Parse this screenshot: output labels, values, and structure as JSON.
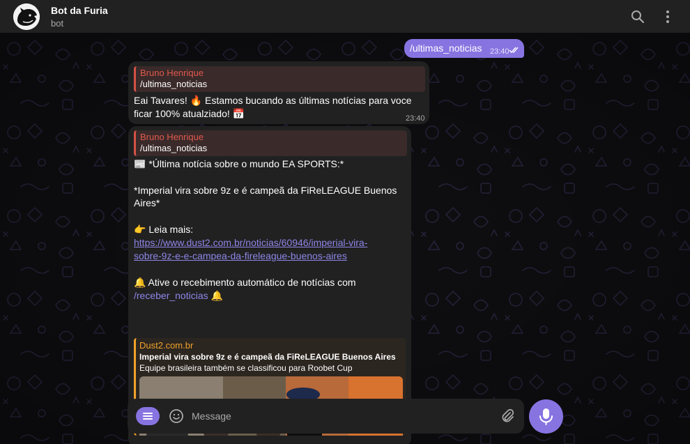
{
  "header": {
    "title": "Bot da Furia",
    "subtitle": "bot",
    "search_icon": "search-icon",
    "more_icon": "more-vertical-icon"
  },
  "messages": {
    "outgoing": {
      "text": "/ultimas_noticias",
      "time": "23:40",
      "status_icon": "double-check-icon"
    },
    "reply1": {
      "reply_name": "Bruno Henrique",
      "reply_text": "/ultimas_noticias",
      "line1": "Eai Tavares! 🔥 Estamos bucando as últimas notícias para voce",
      "line2": "ficar 100% atualziado! 📅",
      "time": "23:40"
    },
    "reply2": {
      "reply_name": "Bruno Henrique",
      "reply_text": "/ultimas_noticias",
      "heading": "📰 *Última notícia sobre o mundo EA SPORTS:*",
      "news_line1": "*Imperial vira sobre 9z e é campeã da FiReLEAGUE Buenos",
      "news_line2": "Aires*",
      "read_more": "👉 Leia mais:",
      "link_line1": "https://www.dust2.com.br/noticias/60946/imperial-vira-",
      "link_line2": "sobre-9z-e-e-campea-da-fireleague-buenos-aires",
      "auto_line": "🔔 Ative o recebimento automático de notícias com",
      "command": "/receber_noticias",
      "bell_emoji": "🔔",
      "preview": {
        "site": "Dust2.com.br",
        "title": "Imperial vira sobre 9z e é campeã da FiReLEAGUE Buenos Aires",
        "description": "Equipe brasileira também se classificou para Roobet Cup"
      }
    }
  },
  "composer": {
    "placeholder": "Message",
    "menu_icon": "menu-icon",
    "emoji_icon": "smile-icon",
    "attach_icon": "paperclip-icon",
    "mic_icon": "microphone-icon"
  },
  "colors": {
    "accent": "#8774e1",
    "reply_bar": "#d45246",
    "preview_bar": "#f0a22a",
    "link": "#8e86e8",
    "bubble": "#212121",
    "header": "#212121"
  }
}
